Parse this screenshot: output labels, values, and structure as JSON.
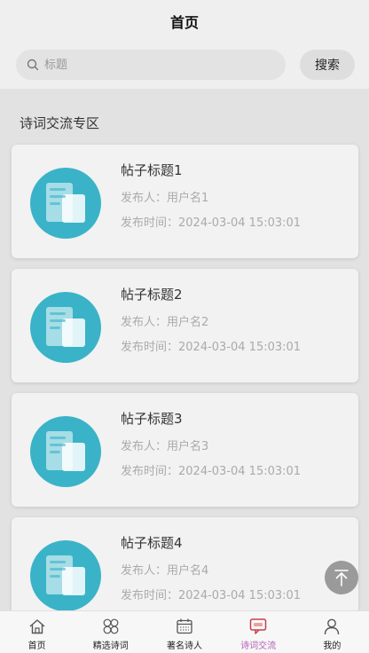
{
  "header": {
    "title": "首页"
  },
  "search": {
    "placeholder": "标题",
    "value": "",
    "button_label": "搜索"
  },
  "section": {
    "title": "诗词交流专区"
  },
  "posts": [
    {
      "title": "帖子标题1",
      "author": "发布人：用户名1",
      "time": "发布时间：2024-03-04 15:03:01"
    },
    {
      "title": "帖子标题2",
      "author": "发布人：用户名2",
      "time": "发布时间：2024-03-04 15:03:01"
    },
    {
      "title": "帖子标题3",
      "author": "发布人：用户名3",
      "time": "发布时间：2024-03-04 15:03:01"
    },
    {
      "title": "帖子标题4",
      "author": "发布人：用户名4",
      "time": "发布时间：2024-03-04 15:03:01"
    }
  ],
  "tabbar": {
    "items": [
      {
        "label": "首页",
        "icon": "home-icon"
      },
      {
        "label": "精选诗词",
        "icon": "flower-icon"
      },
      {
        "label": "著名诗人",
        "icon": "calendar-icon"
      },
      {
        "label": "诗词交流",
        "icon": "chat-icon",
        "active": true
      },
      {
        "label": "我的",
        "icon": "person-icon"
      }
    ]
  },
  "colors": {
    "accent": "#b35fb6",
    "thumb": "#3ab3c8",
    "active_icon": "#c8404a"
  }
}
